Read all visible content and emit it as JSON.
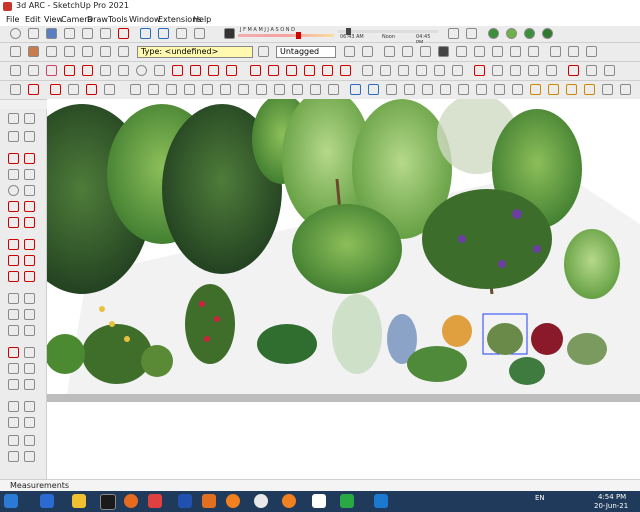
{
  "window": {
    "title": "3d ARC - SketchUp Pro 2021"
  },
  "menu": [
    "File",
    "Edit",
    "View",
    "Camera",
    "Draw",
    "Tools",
    "Window",
    "Extensions",
    "Help"
  ],
  "shadow": {
    "months": "J F M A M J J A S O N D",
    "time_start": "06:43 AM",
    "time_mid": "Noon",
    "time_end": "04:45 PM"
  },
  "toolbar": {
    "type_label": "Type: <undefined>",
    "tag_label": "Untagged"
  },
  "status": {
    "measurements": "Measurements"
  },
  "taskbar": {
    "lang": "EN",
    "time": "4:54 PM",
    "date": "20-Jun-21"
  },
  "colors": {
    "accent": "#d00000",
    "taskbar": "#1f3a5a",
    "type_combo": "#fff9b0"
  }
}
